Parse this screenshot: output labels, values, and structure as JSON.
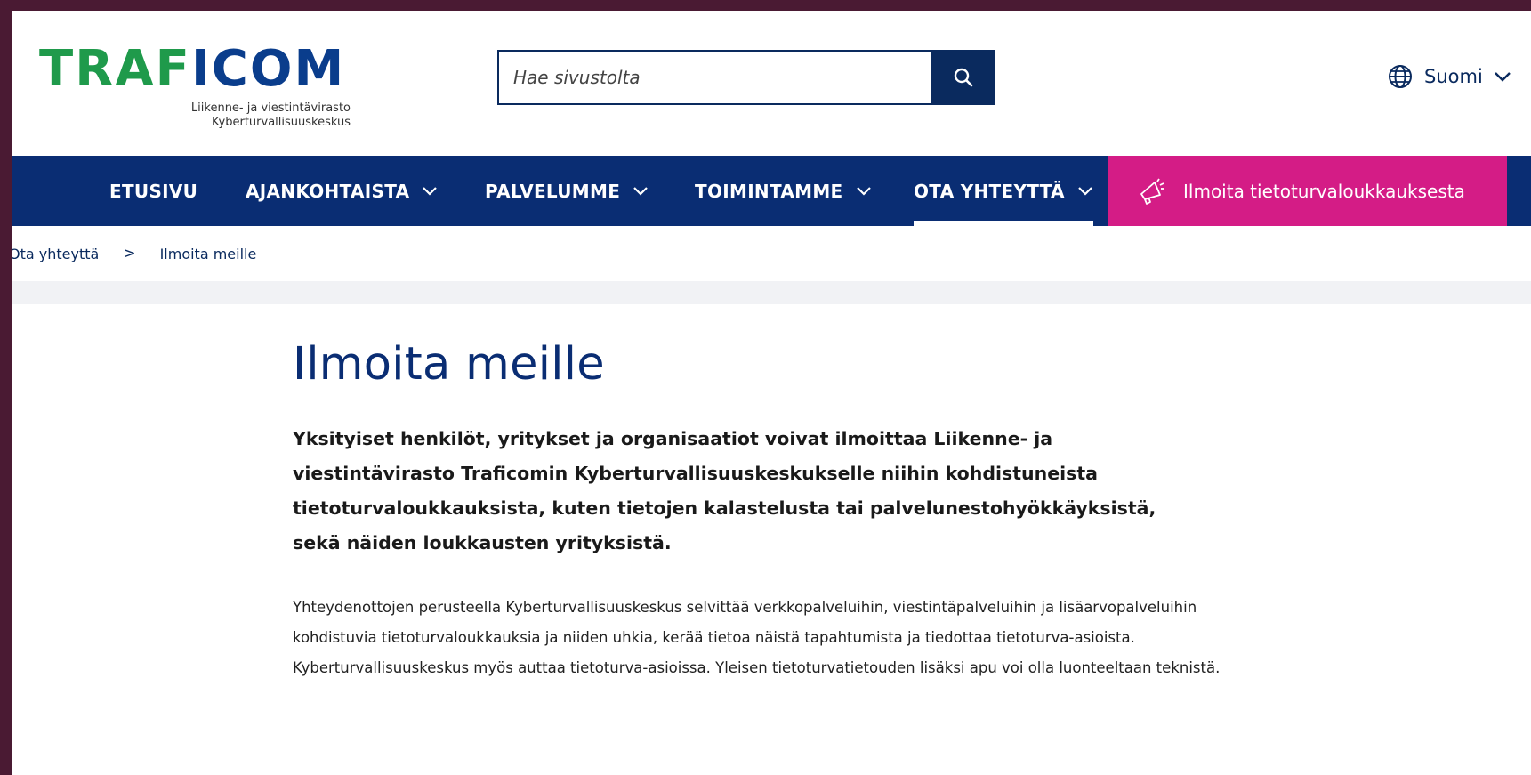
{
  "logo": {
    "wordmark": "TRAFICOM",
    "subtitle_line1": "Liikenne- ja viestintävirasto",
    "subtitle_line2": "Kyberturvallisuuskeskus"
  },
  "search": {
    "placeholder": "Hae sivustolta",
    "button_icon": "search-icon"
  },
  "language": {
    "icon": "globe-icon",
    "label": "Suomi"
  },
  "nav": {
    "items": [
      {
        "label": "ETUSIVU",
        "has_dropdown": false
      },
      {
        "label": "AJANKOHTAISTA",
        "has_dropdown": true
      },
      {
        "label": "PALVELUMME",
        "has_dropdown": true
      },
      {
        "label": "TOIMINTAMME",
        "has_dropdown": true
      },
      {
        "label": "OTA YHTEYTTÄ",
        "has_dropdown": true,
        "active": true
      }
    ],
    "cta": {
      "icon": "megaphone-icon",
      "label": "Ilmoita tietoturvaloukkauksesta"
    }
  },
  "breadcrumb": {
    "items": [
      "Ota yhteyttä",
      "Ilmoita meille"
    ]
  },
  "main": {
    "title": "Ilmoita meille",
    "lead": "Yksityiset henkilöt, yritykset ja organisaatiot voivat ilmoittaa Liikenne- ja viestintävirasto Traficomin Kyberturvallisuuskeskukselle niihin kohdistuneista tietoturvaloukkauksista, kuten tietojen kalastelusta tai palvelunestohyökkäyksistä, sekä näiden loukkausten yrityksistä.",
    "body": "Yhteydenottojen perusteella Kyberturvallisuuskeskus selvittää verkkopalveluihin, viestintäpalveluihin ja lisäarvopalveluihin kohdistuvia tietoturvaloukkauksia ja niiden uhkia, kerää tietoa näistä tapahtumista ja tiedottaa tietoturva-asioista. Kyberturvallisuuskeskus myös auttaa tietoturva-asioissa. Yleisen tietoturvatietouden lisäksi apu voi olla luonteeltaan teknistä."
  },
  "colors": {
    "navy": "#0a2d73",
    "brand_green": "#1f9a4b",
    "cta_magenta": "#d41c86",
    "frame": "#4a1a33"
  }
}
